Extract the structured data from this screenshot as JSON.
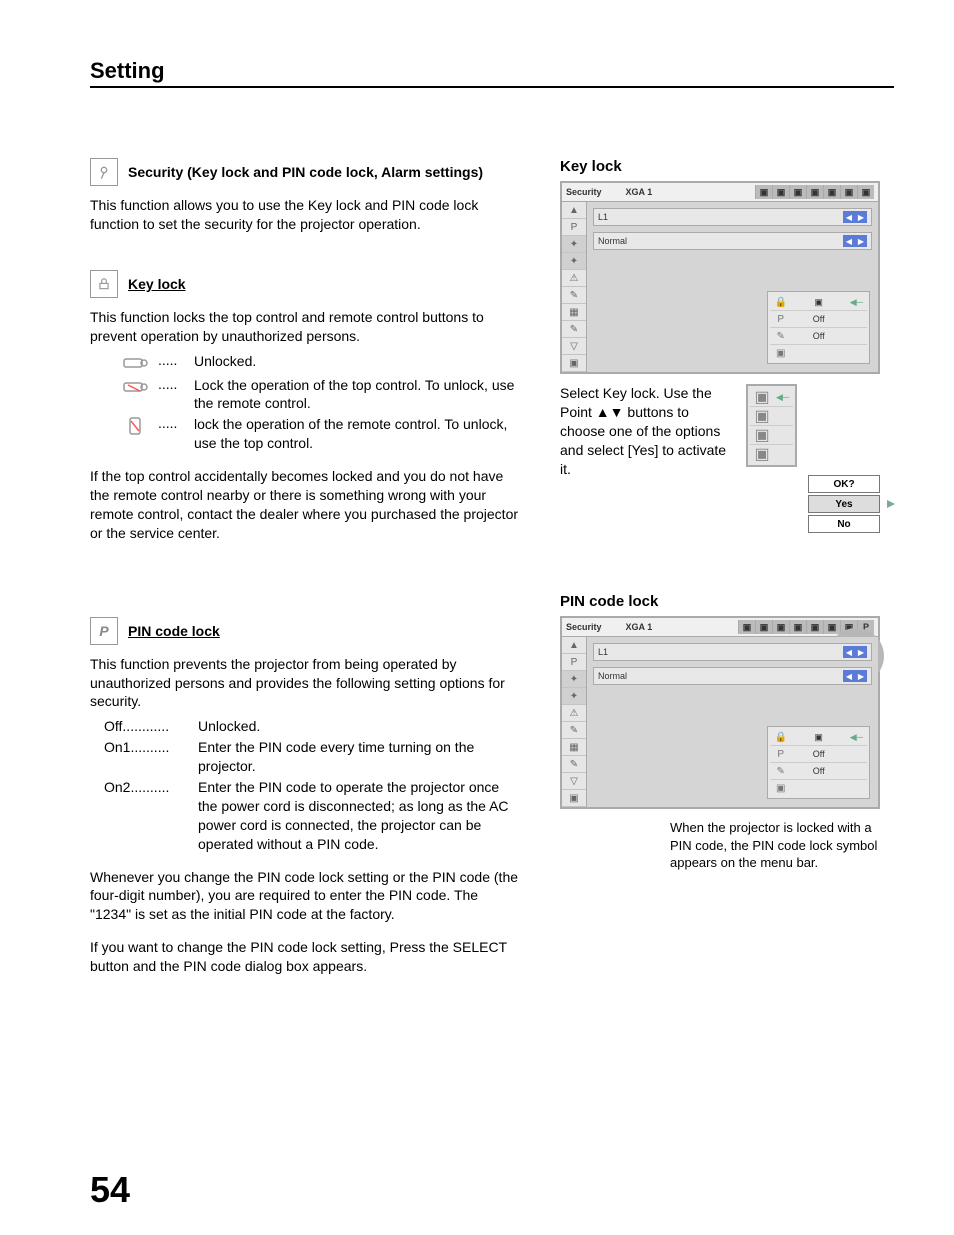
{
  "page": {
    "title": "Setting",
    "number": "54"
  },
  "security_section": {
    "title": "Security (Key lock and PIN code lock, Alarm settings)",
    "desc": "This function allows you to use the Key lock and PIN code lock function to set the security for the projector operation."
  },
  "keylock_section": {
    "title": "Key lock",
    "desc": "This function locks the top control and remote control buttons to prevent operation by unauthorized persons.",
    "dots": ".....",
    "opts": {
      "unlocked": "Unlocked.",
      "top": "Lock the operation of the top control. To unlock, use the remote control.",
      "remote": "lock the operation of the remote control. To unlock, use the top control."
    },
    "warn": "If the top control accidentally becomes locked and you do not have the remote control nearby or there is something wrong with your remote control, contact the dealer where you purchased the projector or the service center."
  },
  "pinlock_section": {
    "title": "PIN code lock",
    "desc": "This function prevents the projector from being operated by unauthorized persons and provides the following setting options for security.",
    "opts": {
      "off_label": "Off............",
      "off_desc": "Unlocked.",
      "on1_label": "On1..........",
      "on1_desc": "Enter the PIN code every time turning on the projector.",
      "on2_label": "On2..........",
      "on2_desc": "Enter the PIN code to operate the projector once the power cord is disconnected; as long as the AC power cord is connected, the projector can be operated without a PIN code."
    },
    "p1": "Whenever you change the PIN code lock setting or the PIN code (the four-digit number), you are required to enter the PIN code. The \"1234\" is set as the initial PIN code at the factory.",
    "p2": "If you want to change the PIN code lock setting, Press the SELECT button and the PIN code dialog box appears."
  },
  "right_keylock": {
    "title": "Key lock",
    "menu": {
      "label": "Security",
      "source": "XGA 1",
      "row1": "L1",
      "row2": "Normal",
      "subvals": {
        "v1": "Off",
        "v2": "Off"
      }
    },
    "note": "Select Key lock. Use the Point ▲▼ buttons to choose one of the options and select [Yes] to activate it.",
    "confirm": {
      "ok": "OK?",
      "yes": "Yes",
      "no": "No"
    }
  },
  "right_pinlock": {
    "title": "PIN code lock",
    "menu": {
      "label": "Security",
      "source": "XGA 1",
      "row1": "L1",
      "row2": "Normal",
      "subvals": {
        "v1": "Off",
        "v2": "Off"
      }
    },
    "badge": "P",
    "caption": "When the projector is locked with a PIN code, the PIN code lock symbol appears on the menu bar."
  }
}
